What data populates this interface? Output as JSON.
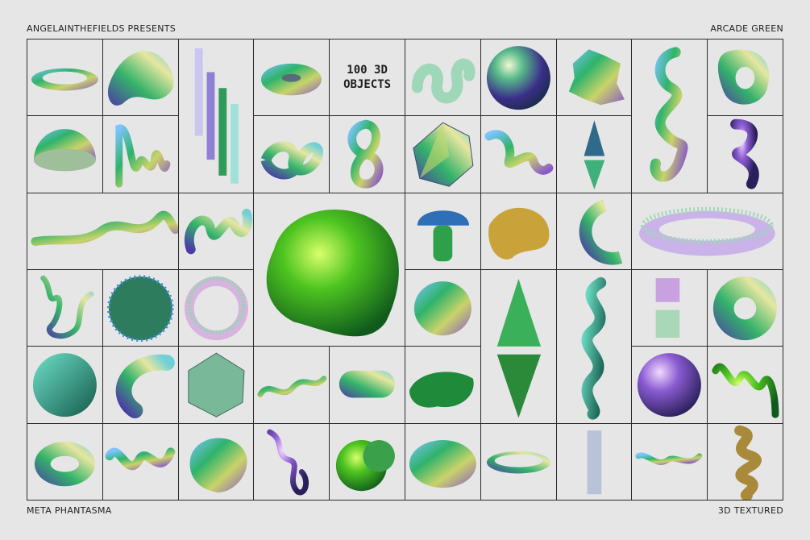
{
  "header": {
    "left": "ANGELAINTHEFIELDS PRESENTS",
    "right": "ARCADE GREEN"
  },
  "footer": {
    "left": "META PHANTASMA",
    "right": "3D TEXTURED"
  },
  "title": {
    "line1": "100 3D",
    "line2": "OBJECTS"
  },
  "colors": {
    "background": "#e6e6e6",
    "grid": "#2a2a2a",
    "accent": "#36b24a"
  },
  "objects": [
    "ring-cutout",
    "wavy-blob",
    "stacked-bars",
    "torus-flat",
    "title",
    "squiggle-textured",
    "sphere",
    "crumpled-blob",
    "s-curve-tall",
    "donut-rounded",
    "hemisphere",
    "zigzag-tube",
    "knot-tube",
    "figure-eight",
    "icosahedron",
    "wave-tube",
    "double-cone",
    "twist-blob",
    "long-wave-tube",
    "coil-tube",
    "big-green-blob",
    "mushroom",
    "melted-blob",
    "c-arc",
    "glitter-ring",
    "zigzag-thin",
    "textured-sphere",
    "glitter-hoop",
    "striped-blob",
    "spike-cone",
    "s-twist",
    "cube-stack",
    "torus-glossy",
    "bumpy-sphere",
    "curved-tube",
    "faceted-icosahedron",
    "wave-thin",
    "capsule-bent",
    "melt-flat",
    "purple-sphere",
    "wave-arch",
    "oval-ring",
    "maze-tube",
    "crumpled-ball",
    "thin-curl",
    "double-sphere",
    "soft-blob",
    "flat-ring",
    "cylinder-tall",
    "small-wave",
    "coil-vertical"
  ]
}
